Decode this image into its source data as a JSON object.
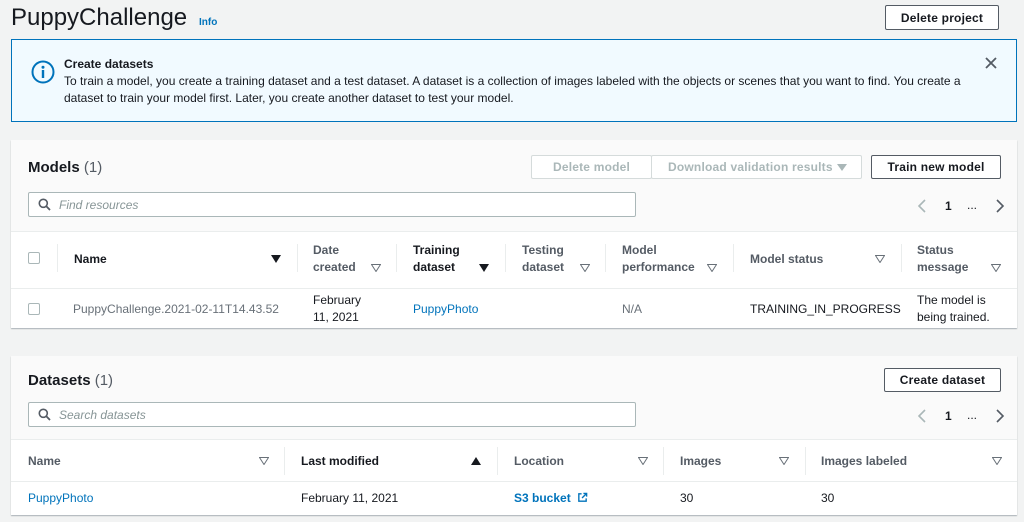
{
  "header": {
    "title": "PuppyChallenge",
    "info_label": "Info",
    "delete_project_label": "Delete project"
  },
  "alert": {
    "title": "Create datasets",
    "text": "To train a model, you create a training dataset and a test dataset. A dataset is a collection of images labeled with the objects or scenes that you want to find. You create a dataset to train your model first. Later, you create another dataset to test your model."
  },
  "models": {
    "title": "Models",
    "count": "(1)",
    "delete_label": "Delete model",
    "download_label": "Download validation results",
    "train_label": "Train new model",
    "search_placeholder": "Find resources",
    "page": "1",
    "ellipsis": "...",
    "columns": [
      "Name",
      "Date created",
      "Training dataset",
      "Testing dataset",
      "Model performance",
      "Model status",
      "Status message"
    ],
    "rows": [
      {
        "name": "PuppyChallenge.2021-02-11T14.43.52",
        "date_created": "February 11, 2021",
        "training_dataset": "PuppyPhoto",
        "testing_dataset": "",
        "performance": "N/A",
        "status": "TRAINING_IN_PROGRESS",
        "message": "The model is being trained."
      }
    ]
  },
  "datasets": {
    "title": "Datasets",
    "count": "(1)",
    "create_label": "Create dataset",
    "search_placeholder": "Search datasets",
    "page": "1",
    "ellipsis": "...",
    "columns": [
      "Name",
      "Last modified",
      "Location",
      "Images",
      "Images labeled"
    ],
    "rows": [
      {
        "name": "PuppyPhoto",
        "last_modified": "February 11, 2021",
        "location": "S3 bucket",
        "images": "30",
        "images_labeled": "30"
      }
    ]
  },
  "colors": {
    "link": "#0073bb",
    "alert_bg": "#f1faff",
    "alert_border": "#0073bb",
    "text": "#16191f"
  }
}
